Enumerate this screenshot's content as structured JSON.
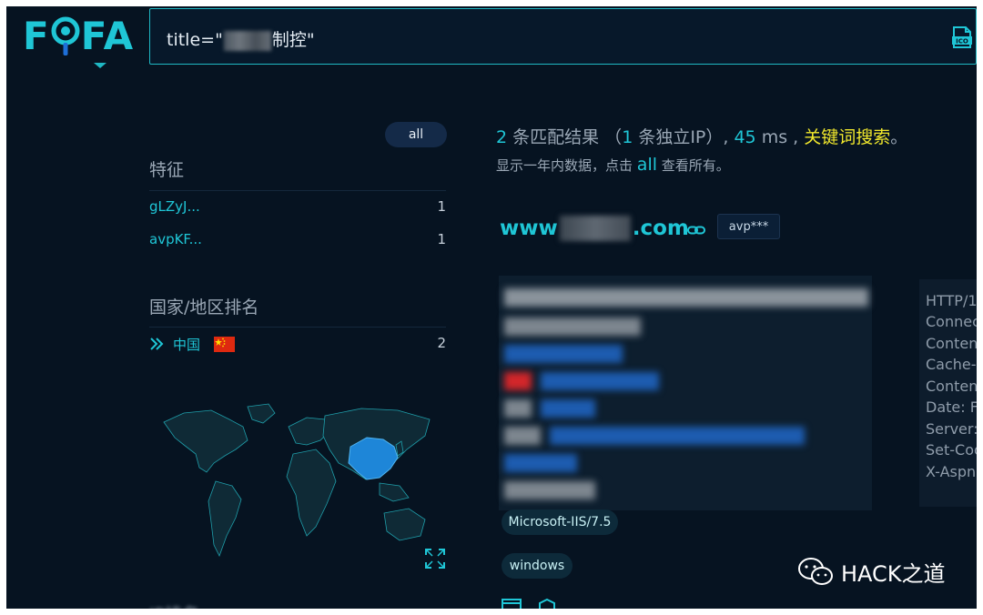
{
  "logo": {
    "text_f": "F",
    "text_fa": "FA"
  },
  "search": {
    "prefix": "title=\"",
    "suffix": "制控\""
  },
  "sidebar": {
    "all_label": "all",
    "features_title": "特征",
    "features": [
      {
        "label": "gLZyJ...",
        "count": "1"
      },
      {
        "label": "avpKF...",
        "count": "1"
      }
    ],
    "country_title": "国家/地区排名",
    "country": {
      "label": "中国",
      "count": "2"
    },
    "next_title": "IP排名"
  },
  "results": {
    "count": "2",
    "count_suffix": " 条匹配结果 （",
    "ip_count": "1",
    "ip_suffix": " 条独立IP）,",
    "time": "45",
    "time_unit": " ms ,",
    "keyword_search": "关键词搜索",
    "keyword_end": "。",
    "sub_prefix": "显示一年内数据，点击",
    "sub_link": "all",
    "sub_suffix": "查看所有。",
    "host_prefix": "www",
    "host_suffix": ".com",
    "cert_tag": "avp***",
    "header_lines": [
      "HTTP/1",
      "Connec",
      "Conten",
      "Cache-",
      "Conten",
      "Date: F",
      "Server:",
      "Set-Coo",
      "X-Aspn"
    ],
    "server_tag": "Microsoft-IIS/7.5",
    "os_tag": "windows"
  },
  "watermark": {
    "text": "HACK之道"
  },
  "colors": {
    "accent": "#1fc6d6",
    "highlight": "#f1e82c",
    "background": "#061321",
    "map_china": "#1e86d8"
  }
}
